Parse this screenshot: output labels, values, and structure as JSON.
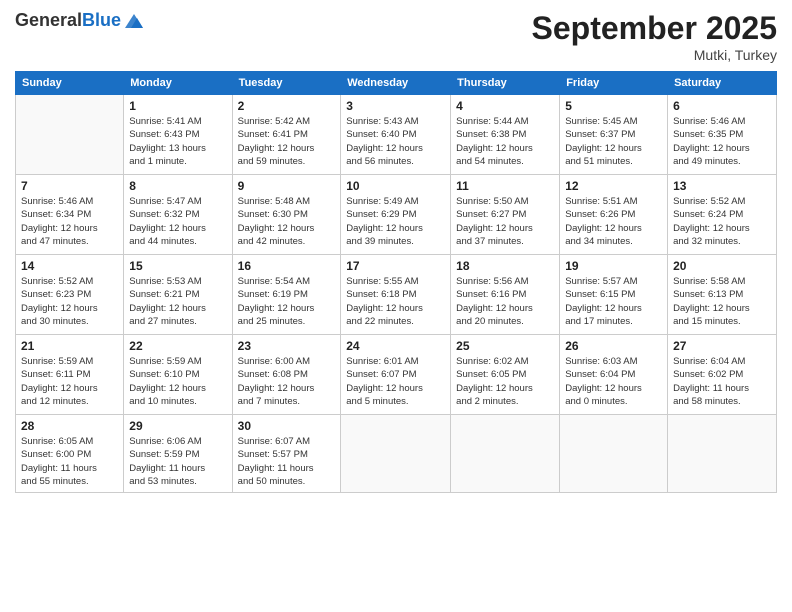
{
  "header": {
    "logo_general": "General",
    "logo_blue": "Blue",
    "month": "September 2025",
    "location": "Mutki, Turkey"
  },
  "weekdays": [
    "Sunday",
    "Monday",
    "Tuesday",
    "Wednesday",
    "Thursday",
    "Friday",
    "Saturday"
  ],
  "weeks": [
    [
      {
        "day": "",
        "info": ""
      },
      {
        "day": "1",
        "info": "Sunrise: 5:41 AM\nSunset: 6:43 PM\nDaylight: 13 hours\nand 1 minute."
      },
      {
        "day": "2",
        "info": "Sunrise: 5:42 AM\nSunset: 6:41 PM\nDaylight: 12 hours\nand 59 minutes."
      },
      {
        "day": "3",
        "info": "Sunrise: 5:43 AM\nSunset: 6:40 PM\nDaylight: 12 hours\nand 56 minutes."
      },
      {
        "day": "4",
        "info": "Sunrise: 5:44 AM\nSunset: 6:38 PM\nDaylight: 12 hours\nand 54 minutes."
      },
      {
        "day": "5",
        "info": "Sunrise: 5:45 AM\nSunset: 6:37 PM\nDaylight: 12 hours\nand 51 minutes."
      },
      {
        "day": "6",
        "info": "Sunrise: 5:46 AM\nSunset: 6:35 PM\nDaylight: 12 hours\nand 49 minutes."
      }
    ],
    [
      {
        "day": "7",
        "info": "Sunrise: 5:46 AM\nSunset: 6:34 PM\nDaylight: 12 hours\nand 47 minutes."
      },
      {
        "day": "8",
        "info": "Sunrise: 5:47 AM\nSunset: 6:32 PM\nDaylight: 12 hours\nand 44 minutes."
      },
      {
        "day": "9",
        "info": "Sunrise: 5:48 AM\nSunset: 6:30 PM\nDaylight: 12 hours\nand 42 minutes."
      },
      {
        "day": "10",
        "info": "Sunrise: 5:49 AM\nSunset: 6:29 PM\nDaylight: 12 hours\nand 39 minutes."
      },
      {
        "day": "11",
        "info": "Sunrise: 5:50 AM\nSunset: 6:27 PM\nDaylight: 12 hours\nand 37 minutes."
      },
      {
        "day": "12",
        "info": "Sunrise: 5:51 AM\nSunset: 6:26 PM\nDaylight: 12 hours\nand 34 minutes."
      },
      {
        "day": "13",
        "info": "Sunrise: 5:52 AM\nSunset: 6:24 PM\nDaylight: 12 hours\nand 32 minutes."
      }
    ],
    [
      {
        "day": "14",
        "info": "Sunrise: 5:52 AM\nSunset: 6:23 PM\nDaylight: 12 hours\nand 30 minutes."
      },
      {
        "day": "15",
        "info": "Sunrise: 5:53 AM\nSunset: 6:21 PM\nDaylight: 12 hours\nand 27 minutes."
      },
      {
        "day": "16",
        "info": "Sunrise: 5:54 AM\nSunset: 6:19 PM\nDaylight: 12 hours\nand 25 minutes."
      },
      {
        "day": "17",
        "info": "Sunrise: 5:55 AM\nSunset: 6:18 PM\nDaylight: 12 hours\nand 22 minutes."
      },
      {
        "day": "18",
        "info": "Sunrise: 5:56 AM\nSunset: 6:16 PM\nDaylight: 12 hours\nand 20 minutes."
      },
      {
        "day": "19",
        "info": "Sunrise: 5:57 AM\nSunset: 6:15 PM\nDaylight: 12 hours\nand 17 minutes."
      },
      {
        "day": "20",
        "info": "Sunrise: 5:58 AM\nSunset: 6:13 PM\nDaylight: 12 hours\nand 15 minutes."
      }
    ],
    [
      {
        "day": "21",
        "info": "Sunrise: 5:59 AM\nSunset: 6:11 PM\nDaylight: 12 hours\nand 12 minutes."
      },
      {
        "day": "22",
        "info": "Sunrise: 5:59 AM\nSunset: 6:10 PM\nDaylight: 12 hours\nand 10 minutes."
      },
      {
        "day": "23",
        "info": "Sunrise: 6:00 AM\nSunset: 6:08 PM\nDaylight: 12 hours\nand 7 minutes."
      },
      {
        "day": "24",
        "info": "Sunrise: 6:01 AM\nSunset: 6:07 PM\nDaylight: 12 hours\nand 5 minutes."
      },
      {
        "day": "25",
        "info": "Sunrise: 6:02 AM\nSunset: 6:05 PM\nDaylight: 12 hours\nand 2 minutes."
      },
      {
        "day": "26",
        "info": "Sunrise: 6:03 AM\nSunset: 6:04 PM\nDaylight: 12 hours\nand 0 minutes."
      },
      {
        "day": "27",
        "info": "Sunrise: 6:04 AM\nSunset: 6:02 PM\nDaylight: 11 hours\nand 58 minutes."
      }
    ],
    [
      {
        "day": "28",
        "info": "Sunrise: 6:05 AM\nSunset: 6:00 PM\nDaylight: 11 hours\nand 55 minutes."
      },
      {
        "day": "29",
        "info": "Sunrise: 6:06 AM\nSunset: 5:59 PM\nDaylight: 11 hours\nand 53 minutes."
      },
      {
        "day": "30",
        "info": "Sunrise: 6:07 AM\nSunset: 5:57 PM\nDaylight: 11 hours\nand 50 minutes."
      },
      {
        "day": "",
        "info": ""
      },
      {
        "day": "",
        "info": ""
      },
      {
        "day": "",
        "info": ""
      },
      {
        "day": "",
        "info": ""
      }
    ]
  ]
}
